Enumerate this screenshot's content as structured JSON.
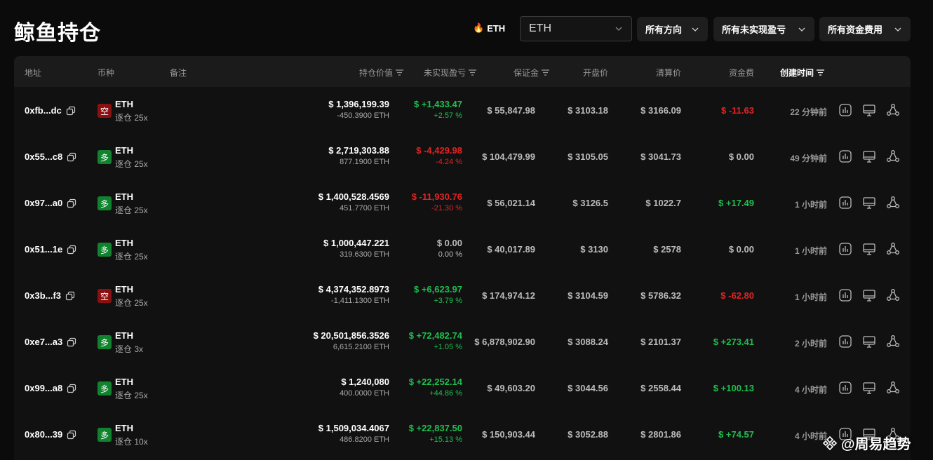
{
  "header": {
    "title": "鲸鱼持仓",
    "eth_tag": "ETH",
    "symbol_select": "ETH",
    "filters": [
      "所有方向",
      "所有未实现盈亏",
      "所有资金费用"
    ]
  },
  "columns": {
    "address": "地址",
    "coin": "币种",
    "note": "备注",
    "position_value": "持仓价值",
    "unrealized_pnl": "未实现盈亏",
    "margin": "保证金",
    "open_price": "开盘价",
    "liq_price": "清算价",
    "funding_fee": "资金费",
    "created_time": "创建时间"
  },
  "rows": [
    {
      "address": "0xfb...dc",
      "side": "空",
      "side_type": "short",
      "coin": "ETH",
      "leverage": "逐仓 25x",
      "value": "$ 1,396,199.39",
      "qty": "-450.3900 ETH",
      "pnl": "$ +1,433.47",
      "pnl_pct": "+2.57 %",
      "pnl_color": "green",
      "margin": "$ 55,847.98",
      "open": "$ 3103.18",
      "liq": "$ 3166.09",
      "fee": "$ -11.63",
      "fee_color": "red",
      "time": "22 分钟前"
    },
    {
      "address": "0x55...c8",
      "side": "多",
      "side_type": "long",
      "coin": "ETH",
      "leverage": "逐仓 25x",
      "value": "$ 2,719,303.88",
      "qty": "877.1900 ETH",
      "pnl": "$ -4,429.98",
      "pnl_pct": "-4.24 %",
      "pnl_color": "red",
      "margin": "$ 104,479.99",
      "open": "$ 3105.05",
      "liq": "$ 3041.73",
      "fee": "$ 0.00",
      "fee_color": "gray",
      "time": "49 分钟前"
    },
    {
      "address": "0x97...a0",
      "side": "多",
      "side_type": "long",
      "coin": "ETH",
      "leverage": "逐仓 25x",
      "value": "$ 1,400,528.4569",
      "qty": "451.7700 ETH",
      "pnl": "$ -11,930.76",
      "pnl_pct": "-21.30 %",
      "pnl_color": "red",
      "margin": "$ 56,021.14",
      "open": "$ 3126.5",
      "liq": "$ 1022.7",
      "fee": "$ +17.49",
      "fee_color": "green",
      "time": "1 小时前"
    },
    {
      "address": "0x51...1e",
      "side": "多",
      "side_type": "long",
      "coin": "ETH",
      "leverage": "逐仓 25x",
      "value": "$ 1,000,447.221",
      "qty": "319.6300 ETH",
      "pnl": "$ 0.00",
      "pnl_pct": "0.00 %",
      "pnl_color": "gray",
      "margin": "$ 40,017.89",
      "open": "$ 3130",
      "liq": "$ 2578",
      "fee": "$ 0.00",
      "fee_color": "gray",
      "time": "1 小时前"
    },
    {
      "address": "0x3b...f3",
      "side": "空",
      "side_type": "short",
      "coin": "ETH",
      "leverage": "逐仓 25x",
      "value": "$ 4,374,352.8973",
      "qty": "-1,411.1300 ETH",
      "pnl": "$ +6,623.97",
      "pnl_pct": "+3.79 %",
      "pnl_color": "green",
      "margin": "$ 174,974.12",
      "open": "$ 3104.59",
      "liq": "$ 5786.32",
      "fee": "$ -62.80",
      "fee_color": "red",
      "time": "1 小时前"
    },
    {
      "address": "0xe7...a3",
      "side": "多",
      "side_type": "long",
      "coin": "ETH",
      "leverage": "逐仓 3x",
      "value": "$ 20,501,856.3526",
      "qty": "6,615.2100 ETH",
      "pnl": "$ +72,482.74",
      "pnl_pct": "+1.05 %",
      "pnl_color": "green",
      "margin": "$ 6,878,902.90",
      "open": "$ 3088.24",
      "liq": "$ 2101.37",
      "fee": "$ +273.41",
      "fee_color": "green",
      "time": "2 小时前"
    },
    {
      "address": "0x99...a8",
      "side": "多",
      "side_type": "long",
      "coin": "ETH",
      "leverage": "逐仓 25x",
      "value": "$ 1,240,080",
      "qty": "400.0000 ETH",
      "pnl": "$ +22,252.14",
      "pnl_pct": "+44.86 %",
      "pnl_color": "green",
      "margin": "$ 49,603.20",
      "open": "$ 3044.56",
      "liq": "$ 2558.44",
      "fee": "$ +100.13",
      "fee_color": "green",
      "time": "4 小时前"
    },
    {
      "address": "0x80...39",
      "side": "多",
      "side_type": "long",
      "coin": "ETH",
      "leverage": "逐仓 10x",
      "value": "$ 1,509,034.4067",
      "qty": "486.8200 ETH",
      "pnl": "$ +22,837.50",
      "pnl_pct": "+15.13 %",
      "pnl_color": "green",
      "margin": "$ 150,903.44",
      "open": "$ 3052.88",
      "liq": "$ 2801.86",
      "fee": "$ +74.57",
      "fee_color": "green",
      "time": "4 小时前"
    }
  ],
  "watermark": "@周易趋势",
  "colors": {
    "green": "#1fbf4f",
    "red": "#e02424",
    "long_badge": "#11822e",
    "short_badge": "#8a1111"
  }
}
